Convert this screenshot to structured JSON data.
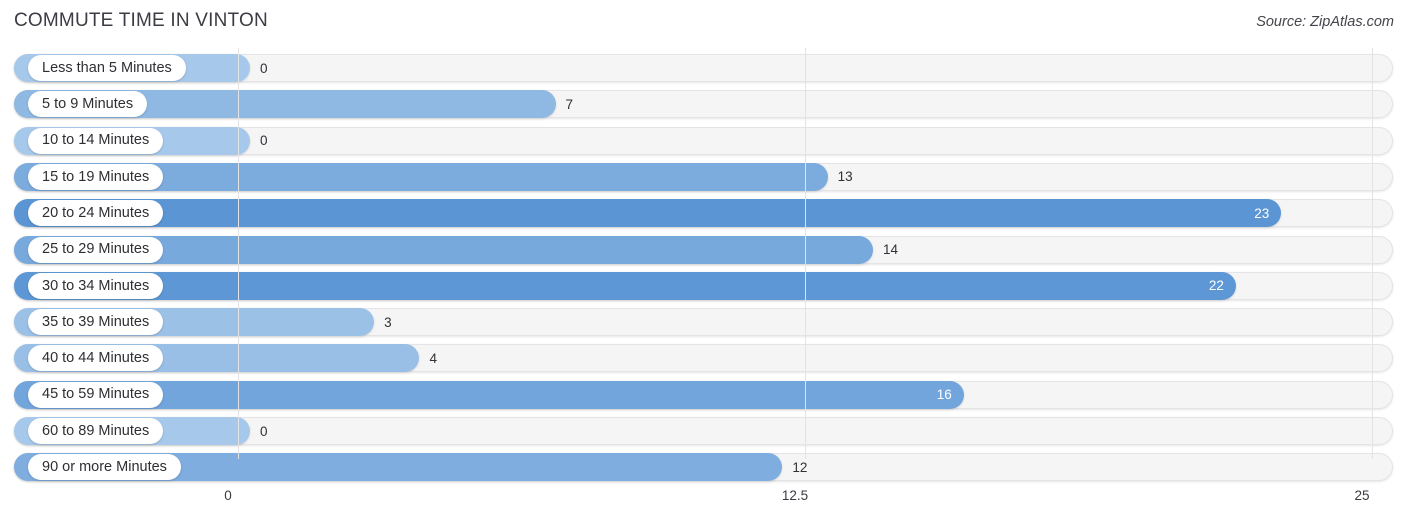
{
  "header": {
    "title": "COMMUTE TIME IN VINTON",
    "source": "Source: ZipAtlas.com"
  },
  "colors": {
    "bar_low": "#a6c8ea",
    "bar_high": "#5b95d4",
    "track": "#f5f5f6",
    "track_border": "#e4e4e6",
    "gridline": "#e3e3e5",
    "label_text": "#2e2e33",
    "value_text": "#303036",
    "value_text_inside": "#ffffff"
  },
  "chart_data": {
    "type": "bar",
    "orientation": "horizontal",
    "title": "COMMUTE TIME IN VINTON",
    "xlabel": "",
    "ylabel": "",
    "xlim": [
      0,
      25
    ],
    "grid": true,
    "legend": false,
    "xticks": [
      "0",
      "12.5",
      "25"
    ],
    "xtick_values": [
      0,
      12.5,
      25
    ],
    "categories": [
      "Less than 5 Minutes",
      "5 to 9 Minutes",
      "10 to 14 Minutes",
      "15 to 19 Minutes",
      "20 to 24 Minutes",
      "25 to 29 Minutes",
      "30 to 34 Minutes",
      "35 to 39 Minutes",
      "40 to 44 Minutes",
      "45 to 59 Minutes",
      "60 to 89 Minutes",
      "90 or more Minutes"
    ],
    "values": [
      0,
      7,
      0,
      13,
      23,
      14,
      22,
      3,
      4,
      16,
      0,
      12
    ],
    "value_labels": [
      "0",
      "7",
      "0",
      "13",
      "23",
      "14",
      "22",
      "3",
      "4",
      "16",
      "0",
      "12"
    ]
  }
}
